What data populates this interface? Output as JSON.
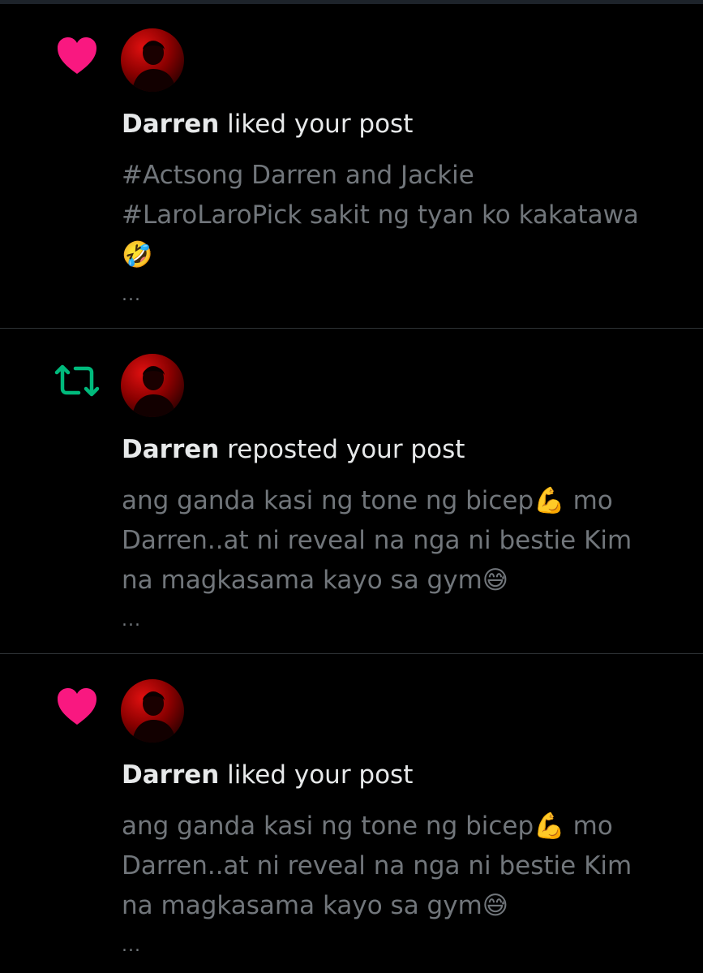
{
  "colors": {
    "background": "#000000",
    "primary_text": "#e7e9ea",
    "secondary_text": "#71767b",
    "like_pink": "#f91880",
    "repost_green": "#00ba7c",
    "divider": "#2f3336"
  },
  "notifications": [
    {
      "type_icon": "heart-icon",
      "user_name": "Darren",
      "action_text": " liked your post",
      "post_text": "#Actsong Darren and Jackie\n#LaroLaroPick sakit ng tyan ko kakatawa\n🤣",
      "more": "..."
    },
    {
      "type_icon": "repost-icon",
      "user_name": "Darren",
      "action_text": " reposted your post",
      "post_text": "ang ganda kasi ng tone ng bicep💪 mo\nDarren..at ni reveal na nga ni bestie Kim\nna magkasama kayo sa gym😅",
      "more": "..."
    },
    {
      "type_icon": "heart-icon",
      "user_name": "Darren",
      "action_text": " liked your post",
      "post_text": "ang ganda kasi ng tone ng bicep💪 mo\nDarren..at ni reveal na nga ni bestie Kim\nna magkasama kayo sa gym😅",
      "more": "..."
    }
  ]
}
